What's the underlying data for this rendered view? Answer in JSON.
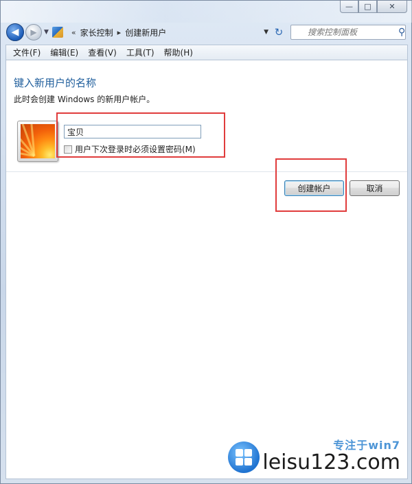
{
  "window": {
    "caption_buttons": {
      "minimize": "—",
      "maximize": "□",
      "close": "✕"
    }
  },
  "nav": {
    "overflow_chevron": "«",
    "breadcrumb": [
      "家长控制",
      "创建新用户"
    ],
    "search_placeholder": "搜索控制面板"
  },
  "menu": [
    "文件(F)",
    "编辑(E)",
    "查看(V)",
    "工具(T)",
    "帮助(H)"
  ],
  "page": {
    "title": "键入新用户的名称",
    "description": "此时会创建 Windows 的新用户帐户。",
    "username_value": "宝贝",
    "require_password_label": "用户下次登录时必须设置密码(M)",
    "require_password_checked": false,
    "create_button": "创建帐户",
    "cancel_button": "取消"
  },
  "watermark": {
    "top": "专注于win7",
    "brand": "leisu123.com"
  },
  "colors": {
    "title": "#1f5e9c",
    "highlight": "#e03b3b"
  }
}
